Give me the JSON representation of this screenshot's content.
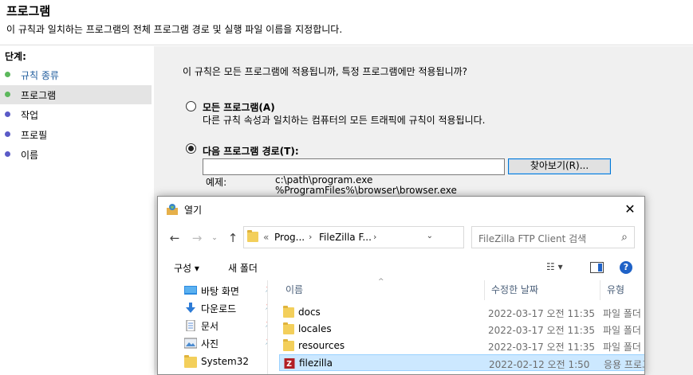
{
  "header": {
    "title": "프로그램",
    "description": "이 규칙과 일치하는 프로그램의 전체 프로그램 경로 및 실행 파일 이름을 지정합니다."
  },
  "steps": {
    "title": "단계:",
    "items": [
      {
        "label": "규칙 종류",
        "color": "#5cb85c"
      },
      {
        "label": "프로그램",
        "color": "#5cb85c"
      },
      {
        "label": "작업",
        "color": "#5b5bc7"
      },
      {
        "label": "프로필",
        "color": "#5b5bc7"
      },
      {
        "label": "이름",
        "color": "#5b5bc7"
      }
    ]
  },
  "main": {
    "question": "이 규칙은 모든 프로그램에 적용됩니까, 특정 프로그램에만 적용됩니까?",
    "option_all_label": "모든 프로그램(A)",
    "option_all_desc": "다른 규칙 속성과 일치하는 컴퓨터의 모든 트래픽에 규칙이 적용됩니다.",
    "option_path_label": "다음 프로그램 경로(T):",
    "path_value": "",
    "browse_label": "찾아보기(R)...",
    "example_label": "예제:",
    "example_line1": "c:\\path\\program.exe",
    "example_line2": "%ProgramFiles%\\browser\\browser.exe"
  },
  "dialog": {
    "title": "열기",
    "close": "✕",
    "address": {
      "prefix": "«",
      "segments": [
        "Prog...",
        "FileZilla F..."
      ]
    },
    "search_placeholder": "FileZilla FTP Client 검색",
    "toolbar": {
      "organize": "구성 ▾",
      "new_folder": "새 폴더",
      "help": "?"
    },
    "nav": [
      {
        "label": "바탕 화면",
        "icon": "desktop-icon",
        "pinned": true
      },
      {
        "label": "다운로드",
        "icon": "download-icon",
        "pinned": true
      },
      {
        "label": "문서",
        "icon": "document-icon",
        "pinned": true
      },
      {
        "label": "사진",
        "icon": "picture-icon",
        "pinned": true
      },
      {
        "label": "System32",
        "icon": "folder-icon",
        "pinned": false
      }
    ],
    "columns": {
      "name": "이름",
      "date": "수정한 날짜",
      "type": "유형"
    },
    "files": [
      {
        "name": "docs",
        "date": "2022-03-17 오전 11:35",
        "type": "파일 폴더"
      },
      {
        "name": "locales",
        "date": "2022-03-17 오전 11:35",
        "type": "파일 폴더"
      },
      {
        "name": "resources",
        "date": "2022-03-17 오전 11:35",
        "type": "파일 폴더"
      },
      {
        "name": "filezilla",
        "date": "2022-02-12 오전 1:50",
        "type": "응용 프로그램"
      }
    ]
  }
}
